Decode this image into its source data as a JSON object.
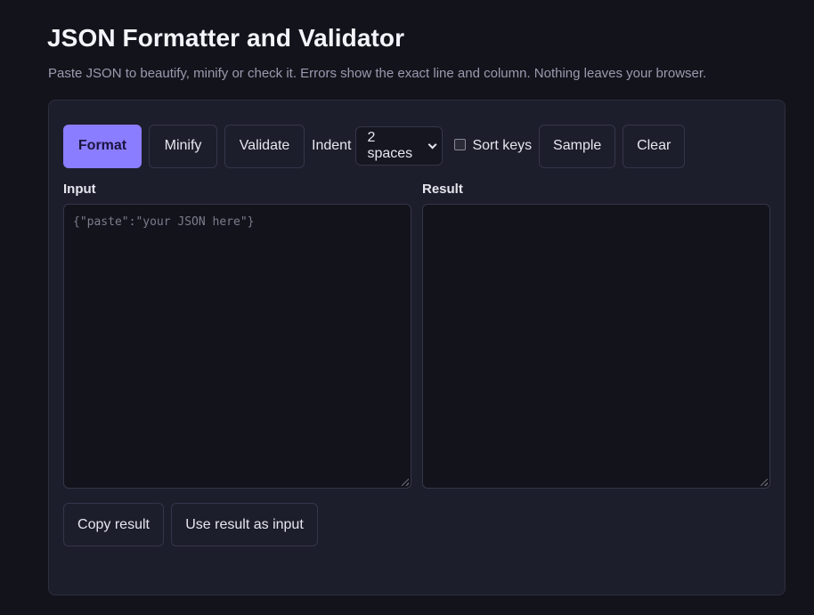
{
  "header": {
    "title": "JSON Formatter and Validator",
    "subtitle": "Paste JSON to beautify, minify or check it. Errors show the exact line and column. Nothing leaves your browser."
  },
  "toolbar": {
    "format_label": "Format",
    "minify_label": "Minify",
    "validate_label": "Validate",
    "indent_label": "Indent",
    "indent_selected": "2 spaces",
    "sort_keys_label": "Sort keys",
    "sort_keys_checked": false,
    "sample_label": "Sample",
    "clear_label": "Clear"
  },
  "input": {
    "label": "Input",
    "value": "",
    "placeholder": "{\"paste\":\"your JSON here\"}"
  },
  "result": {
    "label": "Result",
    "value": ""
  },
  "actions": {
    "copy_label": "Copy result",
    "use_as_input_label": "Use result as input"
  },
  "colors": {
    "background": "#13131c",
    "panel": "#1d1e2b",
    "accent": "#8b7dff"
  }
}
